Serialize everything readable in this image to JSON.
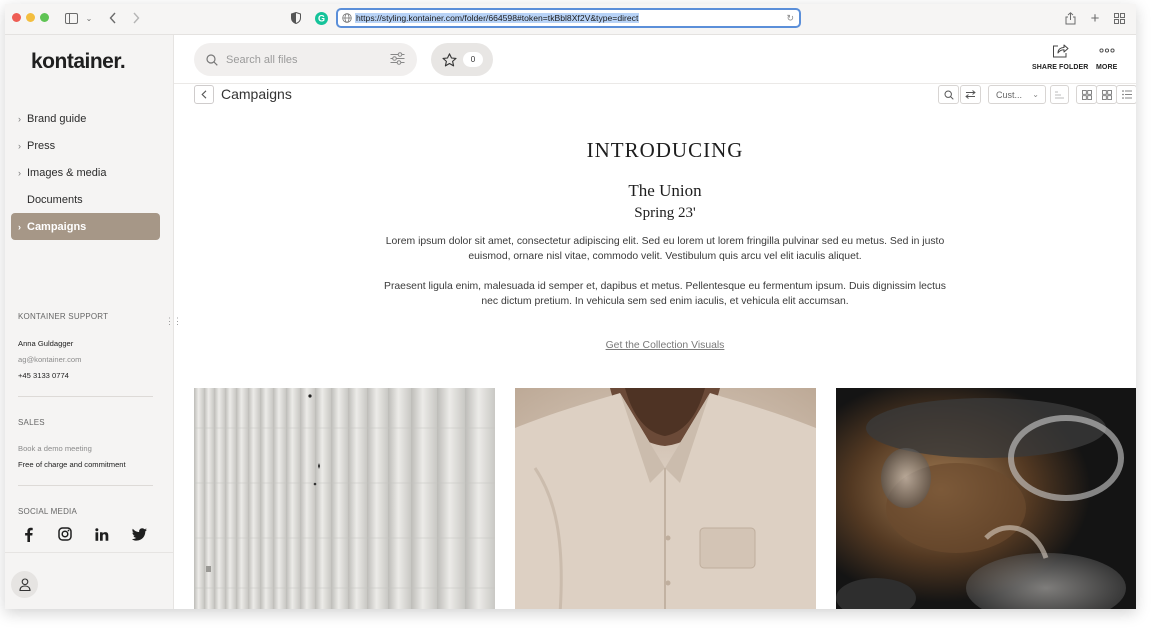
{
  "browser": {
    "url": "https://styling.kontainer.com/folder/664598#token=tkBbl8Xf2V&type=direct"
  },
  "sidebar": {
    "logo": "kontainer.",
    "items": [
      {
        "label": "Brand guide",
        "chevron": true,
        "active": false
      },
      {
        "label": "Press",
        "chevron": true,
        "active": false
      },
      {
        "label": "Images & media",
        "chevron": true,
        "active": false
      },
      {
        "label": "Documents",
        "chevron": false,
        "active": false
      },
      {
        "label": "Campaigns",
        "chevron": true,
        "active": true
      }
    ],
    "support": {
      "title": "KONTAINER SUPPORT",
      "name": "Anna Guldagger",
      "email": "ag@kontainer.com",
      "phone": "+45 3133 0774"
    },
    "sales": {
      "title": "SALES",
      "line1": "Book a demo meeting",
      "line2": "Free of charge and commitment"
    },
    "social": {
      "title": "SOCIAL MEDIA",
      "icons": [
        "facebook-icon",
        "instagram-icon",
        "linkedin-icon",
        "twitter-icon"
      ]
    }
  },
  "topbar": {
    "search_placeholder": "Search all files",
    "favorites_count": "0",
    "share_label": "SHARE FOLDER",
    "more_label": "MORE"
  },
  "toolbar": {
    "breadcrumb": "Campaigns",
    "sort_value": "Cust..."
  },
  "content": {
    "intro": "INTRODUCING",
    "title": "The Union",
    "subtitle": "Spring 23'",
    "para1_line1": "Lorem ipsum dolor sit amet, consectetur adipiscing elit. Sed eu lorem ut lorem fringilla pulvinar sed eu metus. Sed in justo",
    "para1_line2": "euismod, ornare nisl vitae, commodo velit. Vestibulum quis arcu vel elit iaculis aliquet.",
    "para2_line1": "Praesent ligula enim, malesuada id semper et, dapibus et metus. Pellentesque eu fermentum ipsum. Duis dignissim lectus",
    "para2_line2": "nec dictum pretium. In vehicula sem sed enim iaculis, et vehicula elit accumsan.",
    "cta": "Get the Collection Visuals"
  },
  "colors": {
    "accent": "#a69787",
    "url_highlight": "#b8d3f7"
  }
}
